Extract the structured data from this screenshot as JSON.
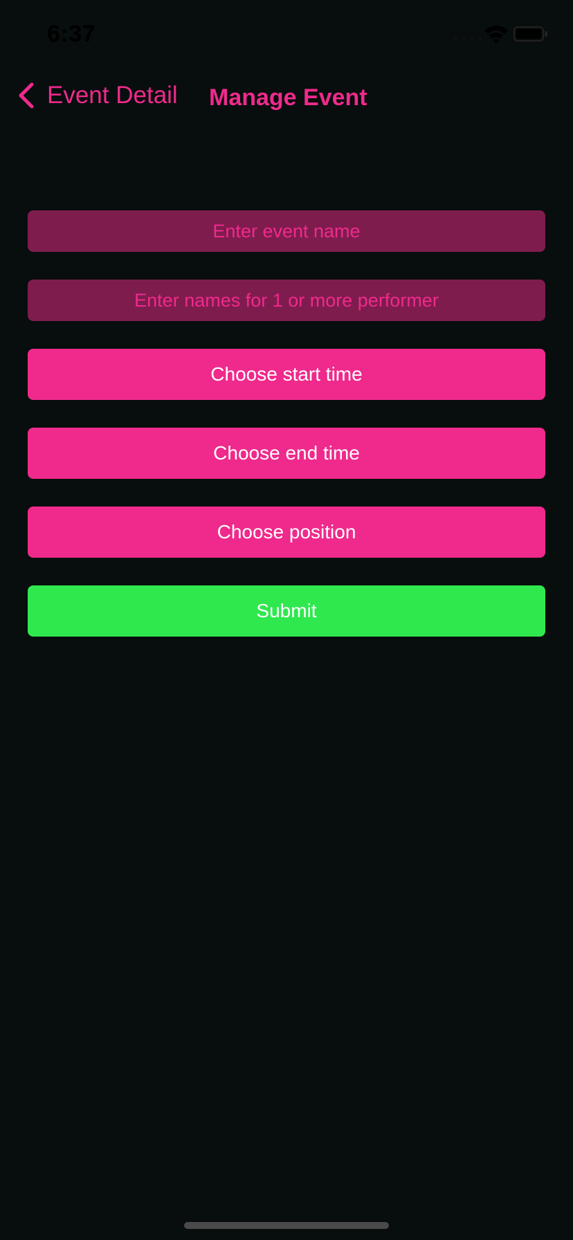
{
  "status_bar": {
    "time": "6:37",
    "icons": [
      "signal-icon",
      "wifi-icon",
      "battery-icon"
    ]
  },
  "nav": {
    "back_label": "Event Detail",
    "back_icon": "chevron-left-icon",
    "title": "Manage Event"
  },
  "form": {
    "event_name_placeholder": "Enter event name",
    "event_name_value": "",
    "performers_placeholder": "Enter names for 1 or more performer",
    "performers_value": "",
    "start_time_label": "Choose start time",
    "end_time_label": "Choose end time",
    "position_label": "Choose position",
    "submit_label": "Submit"
  },
  "colors": {
    "background": "#080d0d",
    "accent": "#ef2a8c",
    "field_background": "#7f1c4e",
    "submit": "#2fe84e",
    "button_text": "#ffffff"
  }
}
